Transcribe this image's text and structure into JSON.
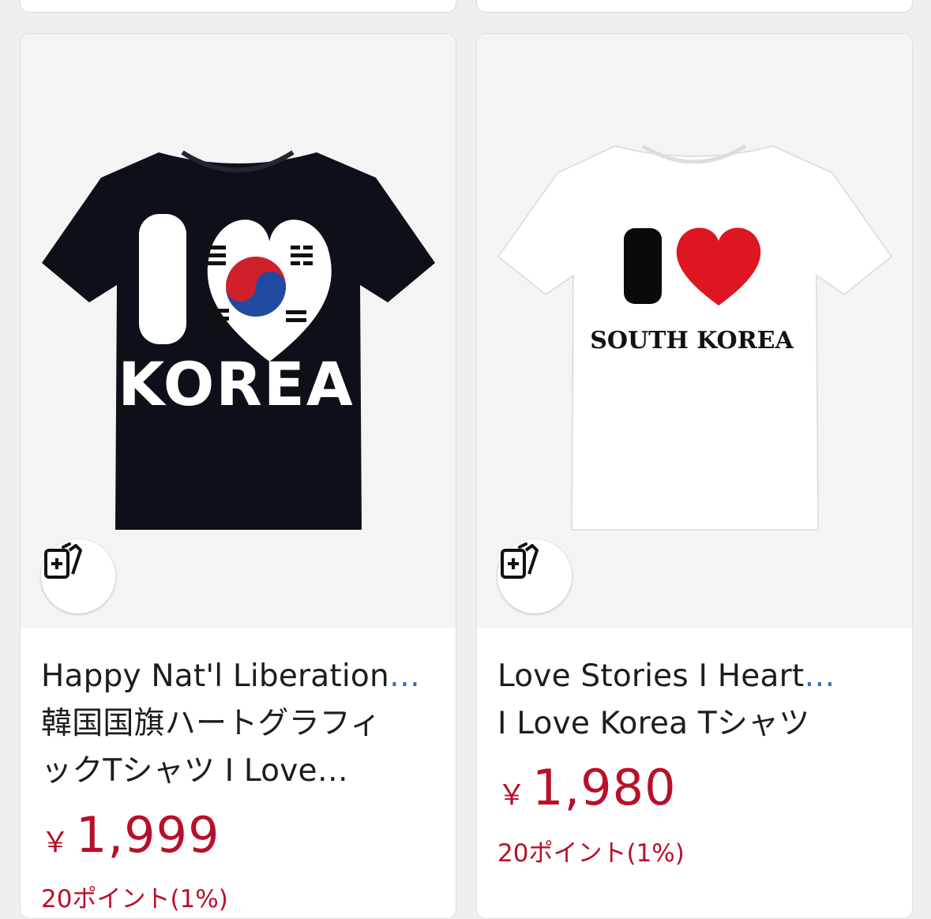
{
  "products": [
    {
      "title_line1": "Happy Nat'l Liberation",
      "title_line2": "韓国国旗ハートグラフィ",
      "title_line3": "ックTシャツ I Love",
      "ellipsis": "…",
      "shirt_text_top": "I",
      "shirt_text_bottom": "KOREA",
      "currency": "￥",
      "price": "1,999",
      "points": "20ポイント(1%)",
      "shirt_color": "#0d1018"
    },
    {
      "title_line1": "Love Stories I Heart",
      "title_line2": "I Love Korea Tシャツ",
      "ellipsis": "…",
      "shirt_text_top": "I",
      "shirt_text_bottom": "SOUTH KOREA",
      "currency": "￥",
      "price": "1,980",
      "points": "20ポイント(1%)",
      "shirt_color": "#ffffff"
    }
  ],
  "icons": {
    "save": "add-to-collection-icon"
  },
  "colors": {
    "price": "#b8102a",
    "ellipsis_link": "#2b6fb3"
  }
}
